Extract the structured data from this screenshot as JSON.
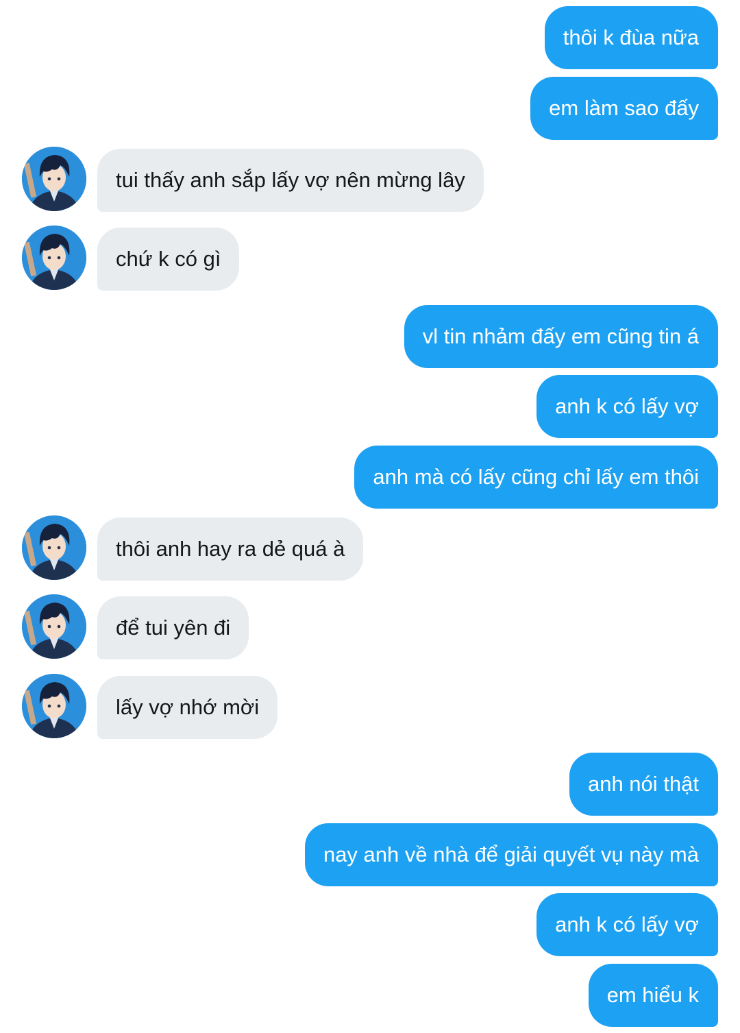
{
  "conversation": {
    "messages": [
      {
        "from": "me",
        "text": "thôi k đùa nữa"
      },
      {
        "from": "me",
        "text": "em làm sao đấy"
      },
      {
        "from": "them",
        "text": "tui thấy anh sắp lấy vợ nên mừng lây"
      },
      {
        "from": "them",
        "text": "chứ k có gì"
      },
      {
        "from": "me",
        "text": "vl tin nhảm đấy em cũng tin á"
      },
      {
        "from": "me",
        "text": "anh k có lấy vợ"
      },
      {
        "from": "me",
        "text": "anh mà có lấy cũng chỉ lấy em thôi"
      },
      {
        "from": "them",
        "text": "thôi anh hay ra dẻ quá à"
      },
      {
        "from": "them",
        "text": "để tui yên đi"
      },
      {
        "from": "them",
        "text": "lấy vợ nhớ mời"
      },
      {
        "from": "me",
        "text": "anh nói thật"
      },
      {
        "from": "me",
        "text": "nay anh về nhà để giải quyết vụ này mà"
      },
      {
        "from": "me",
        "text": "anh k có lấy vợ"
      },
      {
        "from": "me",
        "text": "em hiểu k"
      }
    ]
  },
  "colors": {
    "outgoing_bubble": "#1da1f2",
    "incoming_bubble": "#e8ecef",
    "incoming_text": "#14171a",
    "outgoing_text": "#ffffff"
  },
  "icons": {
    "avatar": "anime-boy-avatar-icon"
  }
}
